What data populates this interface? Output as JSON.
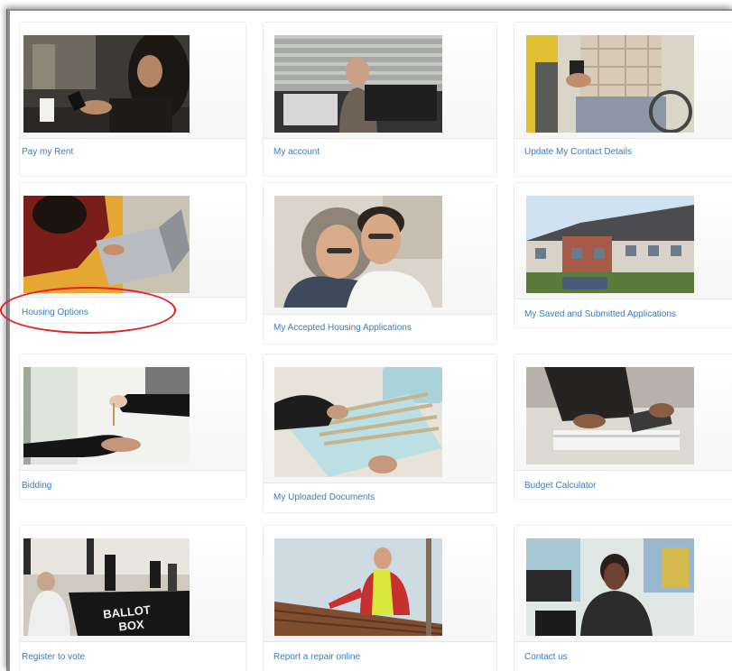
{
  "tiles": [
    {
      "label": "Pay my Rent",
      "photo_icon": "woman-phone-coffee-photo"
    },
    {
      "label": "My account",
      "photo_icon": "man-headset-office-photo"
    },
    {
      "label": "Update My Contact Details",
      "photo_icon": "wheelchair-phone-photo"
    },
    {
      "label": "Housing Options",
      "photo_icon": "woman-laptop-photo"
    },
    {
      "label": "My Accepted Housing Applications",
      "photo_icon": "happy-couple-photo"
    },
    {
      "label": "My Saved and Submitted Applications",
      "photo_icon": "terraced-houses-photo"
    },
    {
      "label": "Bidding",
      "photo_icon": "keys-handover-photo"
    },
    {
      "label": "My Uploaded Documents",
      "photo_icon": "file-folders-photo"
    },
    {
      "label": "Budget Calculator",
      "photo_icon": "calculator-photo"
    },
    {
      "label": "Register to vote",
      "photo_icon": "ballot-box-photo"
    },
    {
      "label": "Report a repair online",
      "photo_icon": "roof-repair-photo"
    },
    {
      "label": "Contact us",
      "photo_icon": "call-centre-photo"
    }
  ],
  "ballot_text": {
    "line1": "BALLOT",
    "line2": "BOX"
  },
  "annotation": {
    "highlight": "Housing Options",
    "color": "#e32028"
  },
  "colors": {
    "link": "#3d7ab8",
    "tile_border": "#ececec"
  }
}
